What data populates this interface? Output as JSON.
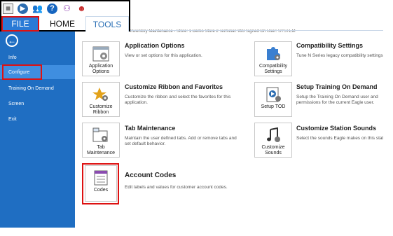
{
  "quick_access": {
    "icons": [
      "grid-icon",
      "play-icon",
      "people-icon",
      "help-icon",
      "multi-user-icon",
      "user-icon"
    ]
  },
  "tabs": {
    "file": "FILE",
    "home": "HOME",
    "tools": "TOOLS"
  },
  "title_strip": "Inventory Maintenance - Store: 1 Demo Store 2 Terminal: 993 Signed On User: SYSTEM",
  "nav": {
    "items": [
      "Info",
      "Configure",
      "Training On Demand",
      "Screen",
      "Exit"
    ],
    "selected": "Configure"
  },
  "options": [
    {
      "tile": "Application Options",
      "title": "Application Options",
      "desc": "View or set options for this application."
    },
    {
      "tile": "Customize Ribbon",
      "title": "Customize Ribbon and Favorites",
      "desc": "Customize the ribbon and select the favorites for this application."
    },
    {
      "tile": "Tab Maintenance",
      "title": "Tab Maintenance",
      "desc": "Maintain the user defined tabs. Add or remove tabs and set default behavior."
    },
    {
      "tile": "Codes",
      "title": "Account Codes",
      "desc": "Edit labels and values for customer account codes."
    },
    {
      "tile": "Compatibility Settings",
      "title": "Compatibility Settings",
      "desc": "Tune N Series legacy compatibility settings"
    },
    {
      "tile": "Setup TOD",
      "title": "Setup Training On Demand",
      "desc": "Setup the Training On Demand user and permissions for the current Eagle user."
    },
    {
      "tile": "Customize Sounds",
      "title": "Customize Station Sounds",
      "desc": "Select the sounds Eagle makes on this station."
    }
  ],
  "colors": {
    "nav_blue": "#1f6ec2",
    "accent_red": "#dd1111",
    "file_tab": "#2a7ad6"
  }
}
